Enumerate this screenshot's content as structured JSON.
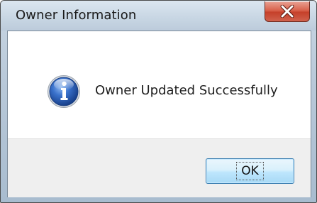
{
  "window": {
    "title": "Owner Information"
  },
  "message": {
    "text": "Owner Updated Successfully",
    "icon": "info-icon"
  },
  "buttons": {
    "ok_label": "OK",
    "close_icon": "close-icon"
  },
  "colors": {
    "titlebar": "#c9d7e4",
    "close_button": "#d0543e",
    "button_area": "#efefef",
    "info_icon": "#2a5fb0"
  }
}
